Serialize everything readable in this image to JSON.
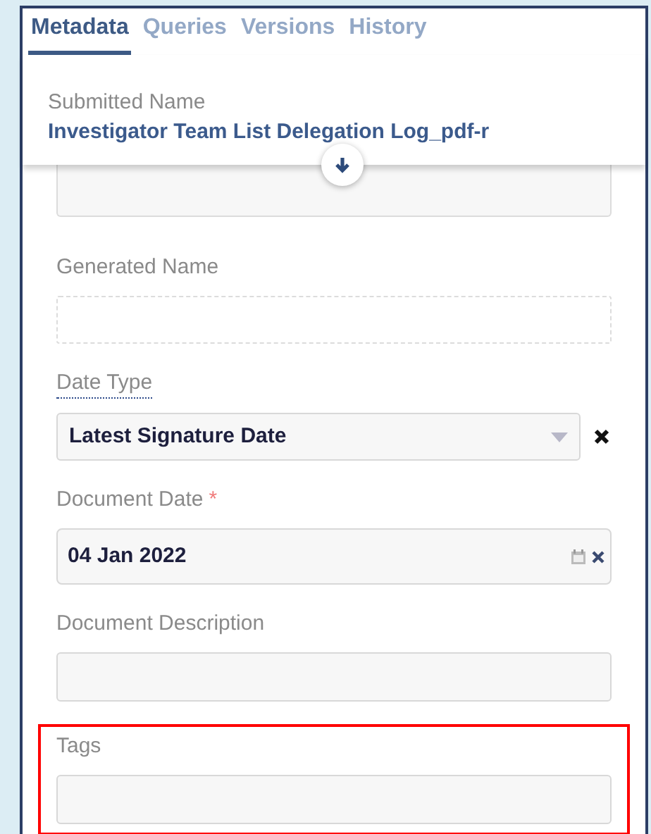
{
  "tabs": [
    {
      "label": "Metadata",
      "selected": true
    },
    {
      "label": "Queries",
      "selected": false
    },
    {
      "label": "Versions",
      "selected": false
    },
    {
      "label": "History",
      "selected": false
    }
  ],
  "submitted": {
    "label": "Submitted Name",
    "value": "Investigator Team List Delegation Log_pdf-r"
  },
  "fields": [
    {
      "kind": "covered"
    },
    {
      "kind": "readonly",
      "label": "Generated Name"
    },
    {
      "kind": "select",
      "label": "Date Type",
      "help": true,
      "value": "Latest Signature Date"
    },
    {
      "kind": "date",
      "label": "Document Date",
      "required": true,
      "required_mark": "*",
      "value": "04 Jan 2022"
    },
    {
      "kind": "text",
      "label": "Document Description"
    },
    {
      "kind": "text",
      "label": "Tags",
      "highlighted": true
    }
  ]
}
